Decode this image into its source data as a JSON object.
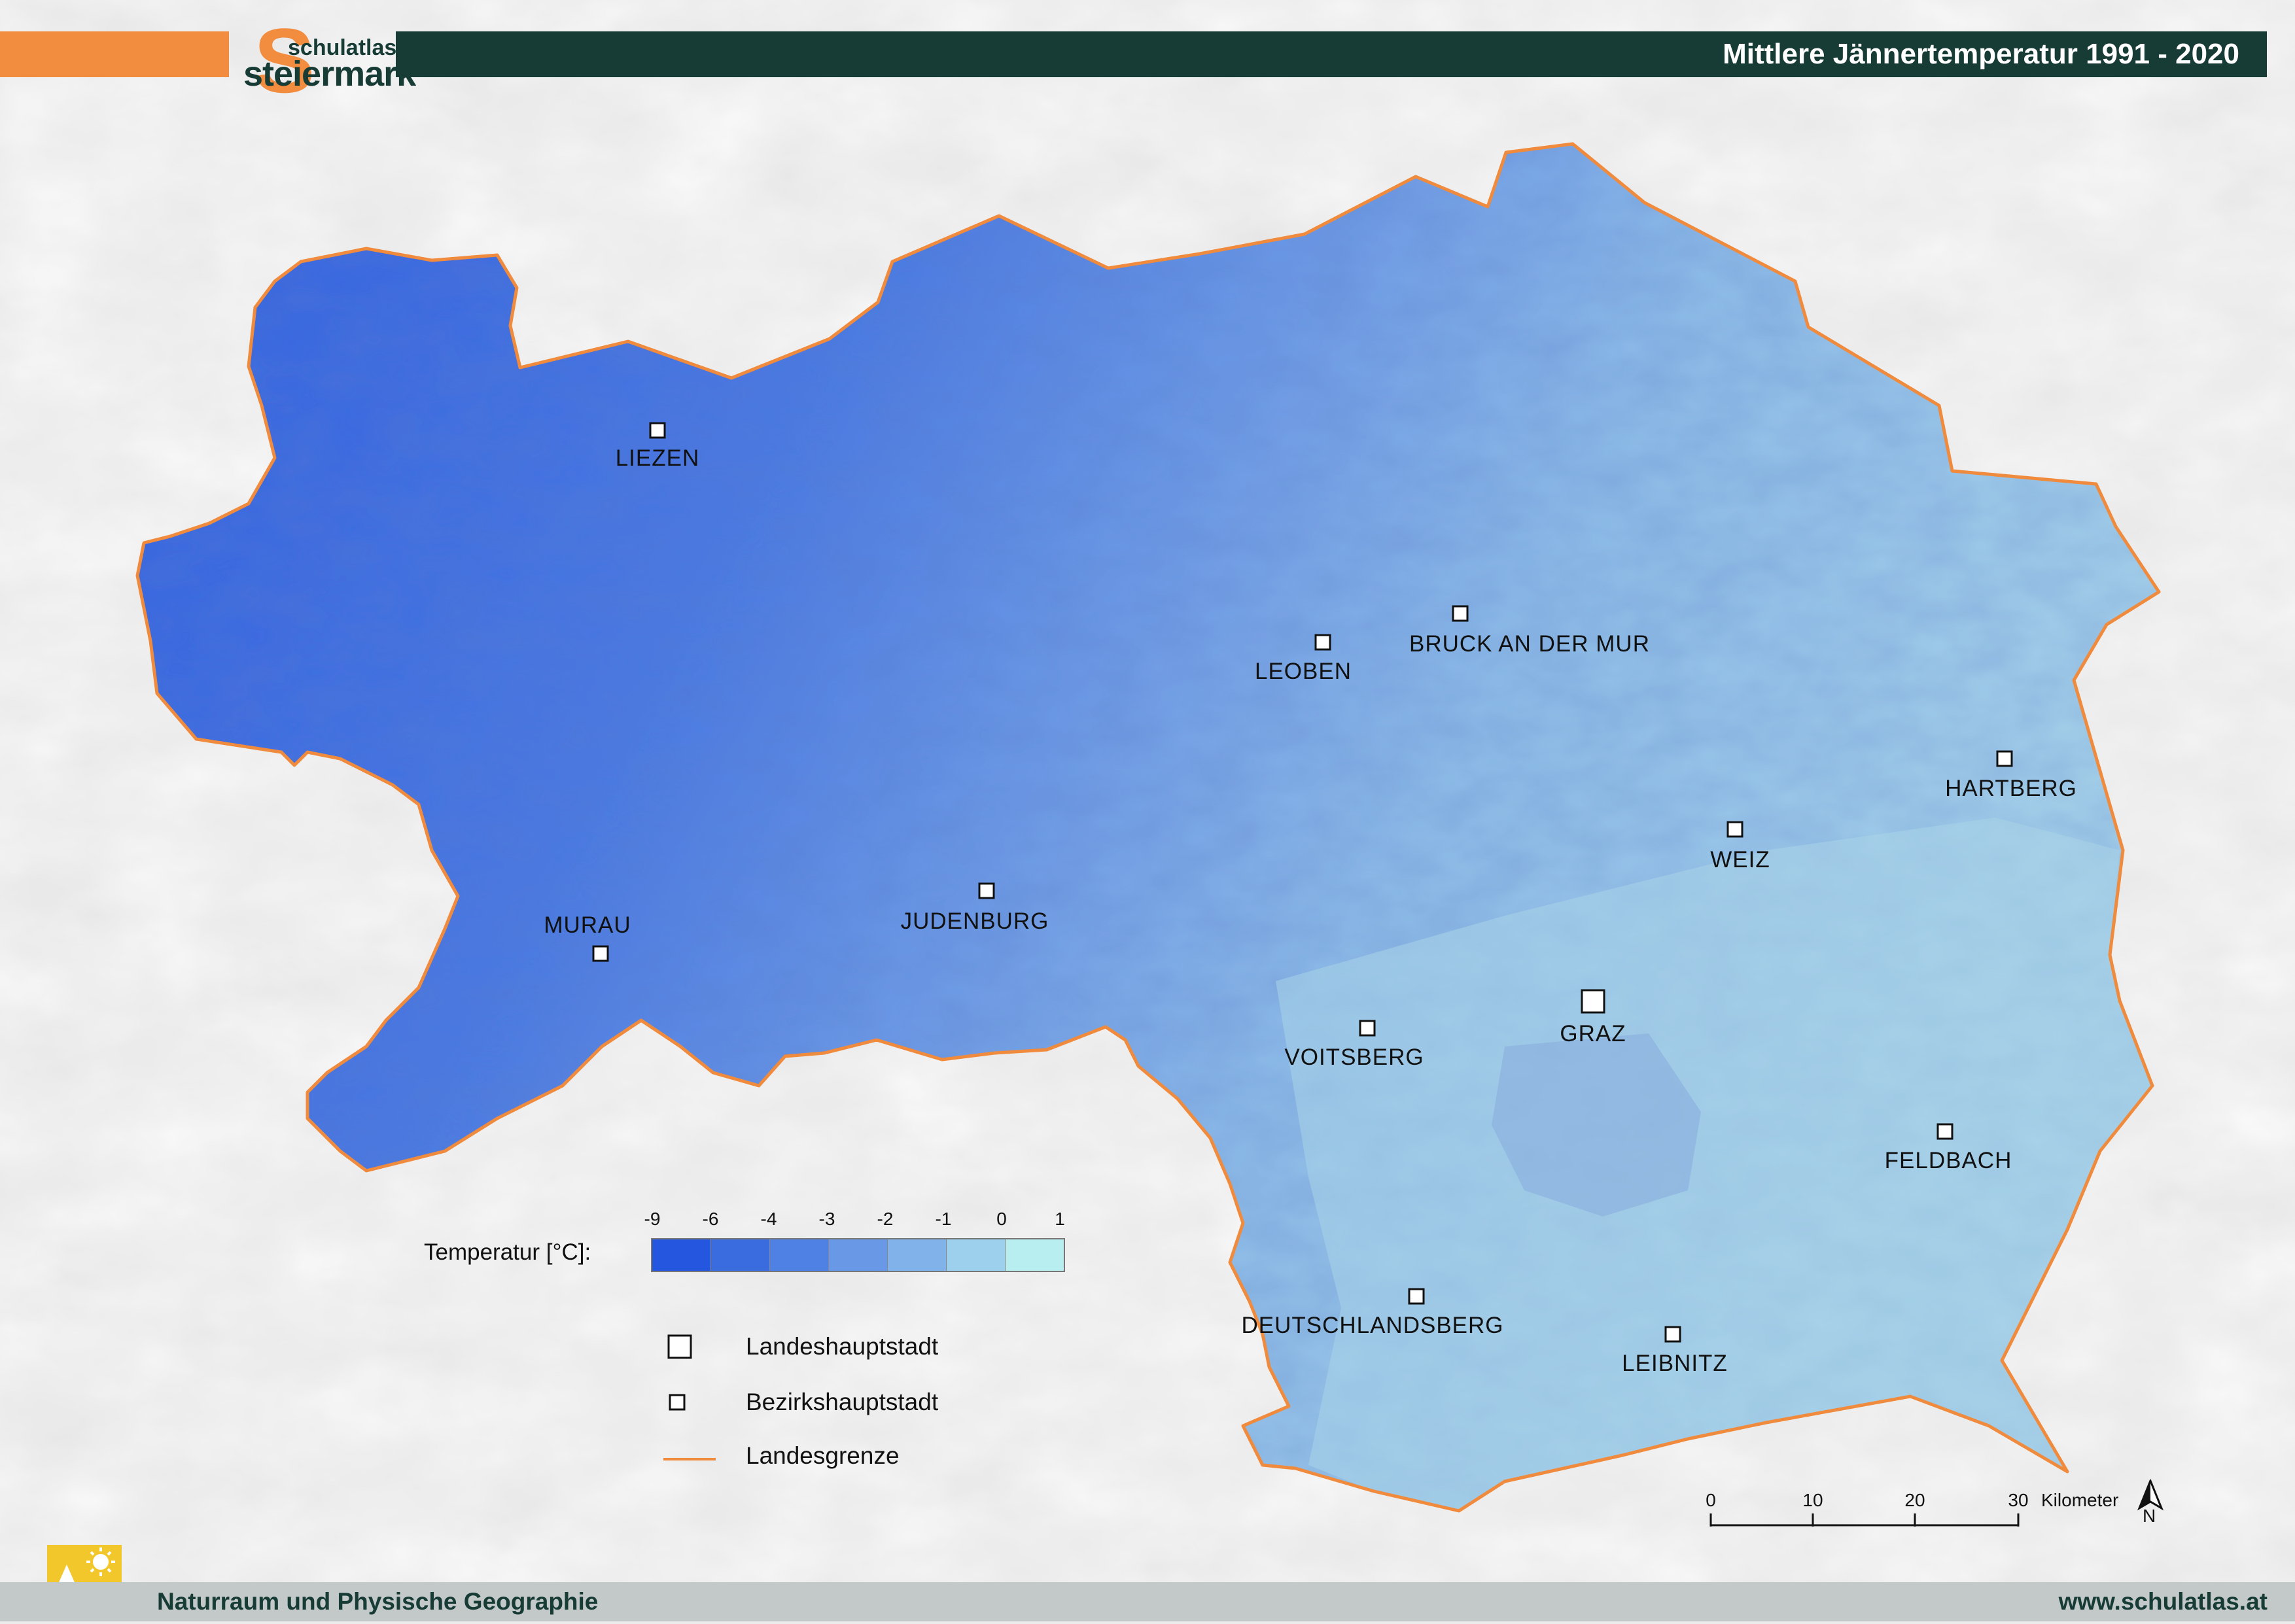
{
  "header": {
    "title": "Mittlere Jännertemperatur 1991 - 2020",
    "logo_small": "schulatlas",
    "logo_main": "steiermark",
    "logo_letter": "S"
  },
  "cities": [
    {
      "name": "LIEZEN",
      "type": "bezirk"
    },
    {
      "name": "LEOBEN",
      "type": "bezirk"
    },
    {
      "name": "BRUCK AN DER MUR",
      "type": "bezirk"
    },
    {
      "name": "HARTBERG",
      "type": "bezirk"
    },
    {
      "name": "WEIZ",
      "type": "bezirk"
    },
    {
      "name": "MURAU",
      "type": "bezirk"
    },
    {
      "name": "JUDENBURG",
      "type": "bezirk"
    },
    {
      "name": "VOITSBERG",
      "type": "bezirk"
    },
    {
      "name": "GRAZ",
      "type": "landeshauptstadt"
    },
    {
      "name": "FELDBACH",
      "type": "bezirk"
    },
    {
      "name": "DEUTSCHLANDSBERG",
      "type": "bezirk"
    },
    {
      "name": "LEIBNITZ",
      "type": "bezirk"
    }
  ],
  "legend": {
    "temperature_label": "Temperatur [°C]:",
    "ticks": [
      "-9",
      "-6",
      "-4",
      "-3",
      "-2",
      "-1",
      "0",
      "1"
    ],
    "colors": [
      "#2456e0",
      "#3a6ce0",
      "#4f80e4",
      "#6898e6",
      "#82b2ea",
      "#9dd0ec",
      "#b9eef0"
    ],
    "capital_label": "Landeshauptstadt",
    "district_label": "Bezirkshauptstadt",
    "border_label": "Landesgrenze",
    "border_color": "#f08a3c"
  },
  "scale": {
    "labels": [
      "0",
      "10",
      "20",
      "30"
    ],
    "unit": "Kilometer",
    "north": "N"
  },
  "footer": {
    "left": "Naturraum und Physische Geographie",
    "right": "www.schulatlas.at"
  }
}
